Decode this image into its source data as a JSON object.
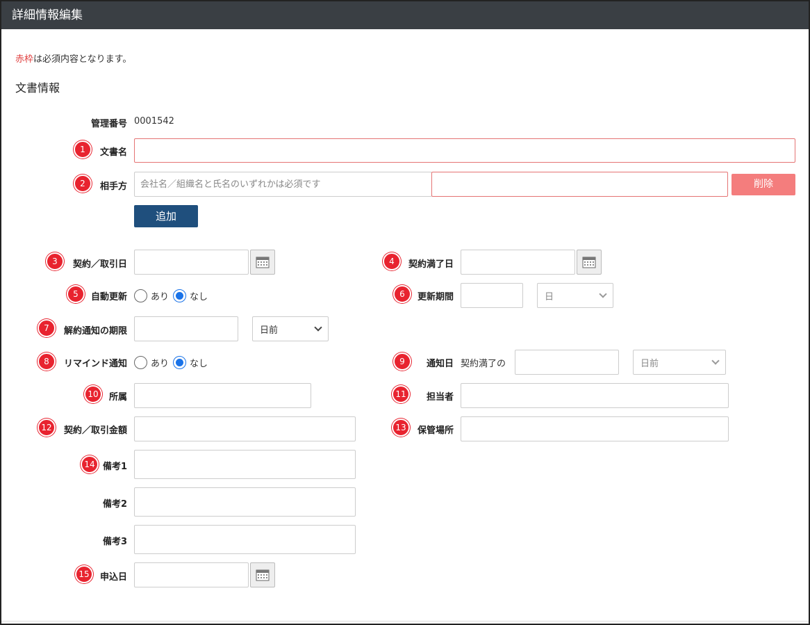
{
  "header": {
    "title": "詳細情報編集"
  },
  "note": {
    "red": "赤枠",
    "rest": "は必須内容となります。"
  },
  "section_title": "文書情報",
  "fields": {
    "mgmt_no": {
      "label": "管理番号",
      "value": "0001542"
    },
    "doc_name": {
      "badge": "1",
      "label": "文書名",
      "value": ""
    },
    "party": {
      "badge": "2",
      "label": "相手方",
      "placeholder": "会社名／組織名と氏名のいずれかは必須です",
      "value2": "",
      "delete_label": "削除",
      "add_label": "追加"
    },
    "contract_date": {
      "badge": "3",
      "label": "契約／取引日",
      "value": ""
    },
    "expiry_date": {
      "badge": "4",
      "label": "契約満了日",
      "value": ""
    },
    "auto_renew": {
      "badge": "5",
      "label": "自動更新",
      "opt_yes": "あり",
      "opt_no": "なし",
      "selected": "なし"
    },
    "renew_period": {
      "badge": "6",
      "label": "更新期間",
      "value": "",
      "unit": "日"
    },
    "cancel_deadline": {
      "badge": "7",
      "label": "解約通知の期限",
      "value": "",
      "unit": "日前"
    },
    "reminder": {
      "badge": "8",
      "label": "リマインド通知",
      "opt_yes": "あり",
      "opt_no": "なし",
      "selected": "なし"
    },
    "notify_date": {
      "badge": "9",
      "label": "通知日",
      "prefix": "契約満了の",
      "value": "",
      "unit": "日前"
    },
    "dept": {
      "badge": "10",
      "label": "所属",
      "value": ""
    },
    "person": {
      "badge": "11",
      "label": "担当者",
      "value": ""
    },
    "amount": {
      "badge": "12",
      "label": "契約／取引金額",
      "value": ""
    },
    "storage": {
      "badge": "13",
      "label": "保管場所",
      "value": ""
    },
    "remark1": {
      "badge": "14",
      "label": "備考1",
      "value": ""
    },
    "remark2": {
      "label": "備考2",
      "value": ""
    },
    "remark3": {
      "label": "備考3",
      "value": ""
    },
    "apply_date": {
      "badge": "15",
      "label": "申込日",
      "value": ""
    }
  }
}
